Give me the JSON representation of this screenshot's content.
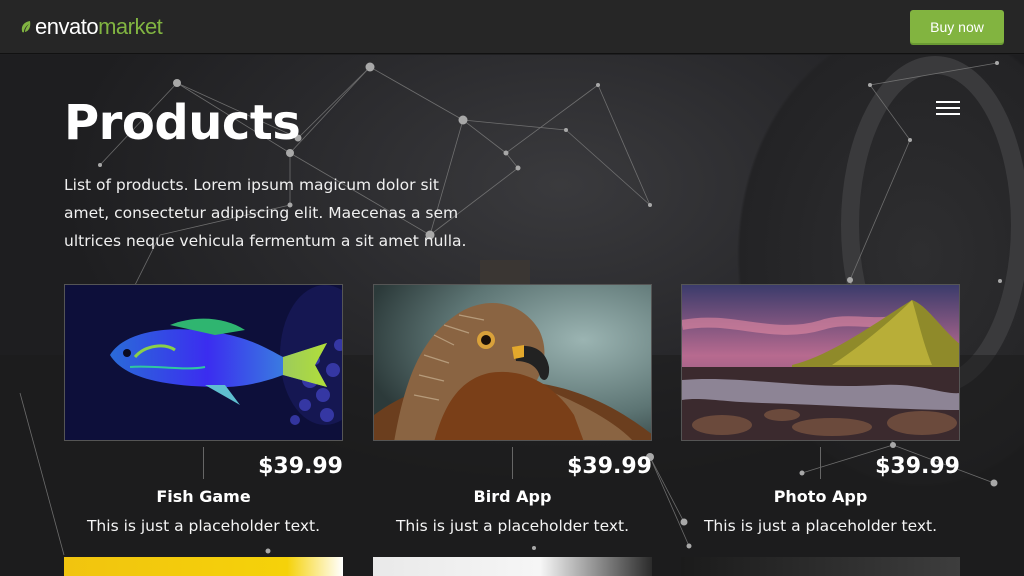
{
  "header": {
    "brand": "envato",
    "product": "market",
    "buy_label": "Buy now"
  },
  "hero": {
    "title": "Products",
    "intro": "List of products. Lorem ipsum magicum dolor sit amet, consectetur adipiscing elit. Maecenas a sem ultrices neque vehicula fermentum a sit amet nulla."
  },
  "products": [
    {
      "name": "Fish Game",
      "price": "$39.99",
      "description": "This is just a placeholder text.",
      "image": "fish-image"
    },
    {
      "name": "Bird App",
      "price": "$39.99",
      "description": "This is just a placeholder text.",
      "image": "bird-image"
    },
    {
      "name": "Photo App",
      "price": "$39.99",
      "description": "This is just a placeholder text.",
      "image": "landscape-image"
    }
  ],
  "colors": {
    "accent": "#82b440",
    "topbar": "#262626",
    "background": "#222224"
  },
  "icons": [
    "leaf-icon",
    "hamburger-menu-icon"
  ]
}
